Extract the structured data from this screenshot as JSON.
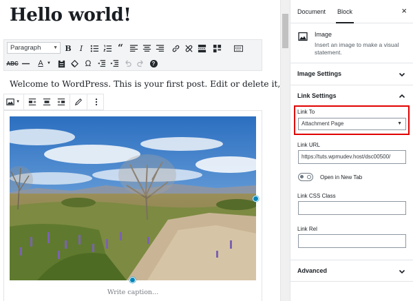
{
  "editor": {
    "post_title": "Hello world!",
    "classic_toolbar": {
      "format_select": "Paragraph",
      "row1_icons": [
        "bold-icon",
        "italic-icon",
        "bullet-list-icon",
        "numbered-list-icon",
        "blockquote-icon",
        "align-left-icon",
        "align-center-icon",
        "align-right-icon",
        "link-icon",
        "unlink-icon",
        "read-more-icon",
        "toolbar-toggle-icon",
        "keyboard-icon"
      ],
      "row2_icons": [
        "strikethrough-icon",
        "horizontal-line-icon",
        "text-color-icon",
        "paste-text-icon",
        "clear-formatting-icon",
        "special-character-icon",
        "outdent-icon",
        "indent-icon",
        "undo-icon",
        "redo-icon",
        "help-icon"
      ],
      "bold_label": "B",
      "italic_label": "I",
      "special_char_label": "Ω",
      "text_color_label": "A",
      "help_label": "?"
    },
    "paragraph_text": "Welcome to WordPress. This is your first post. Edit or delete it, then start",
    "image_caption_placeholder": "Write caption..."
  },
  "sidebar": {
    "tabs": [
      {
        "label": "Document",
        "active": false
      },
      {
        "label": "Block",
        "active": true
      }
    ],
    "close_label": "×",
    "block": {
      "name": "Image",
      "description": "Insert an image to make a visual statement."
    },
    "panels": {
      "image_settings": {
        "title": "Image Settings",
        "expanded": false
      },
      "link_settings": {
        "title": "Link Settings",
        "expanded": true,
        "link_to_label": "Link To",
        "link_to_value": "Attachment Page",
        "link_url_label": "Link URL",
        "link_url_value": "https://tuts.wpmudev.host/dsc00500/",
        "new_tab_label": "Open in New Tab",
        "new_tab_enabled": false,
        "css_class_label": "Link CSS Class",
        "css_class_value": "",
        "link_rel_label": "Link Rel",
        "link_rel_value": ""
      },
      "advanced": {
        "title": "Advanced",
        "expanded": false
      }
    }
  },
  "colors": {
    "accent_blue": "#0085ba",
    "highlight_red": "#e00000",
    "border": "#e2e4e7"
  }
}
